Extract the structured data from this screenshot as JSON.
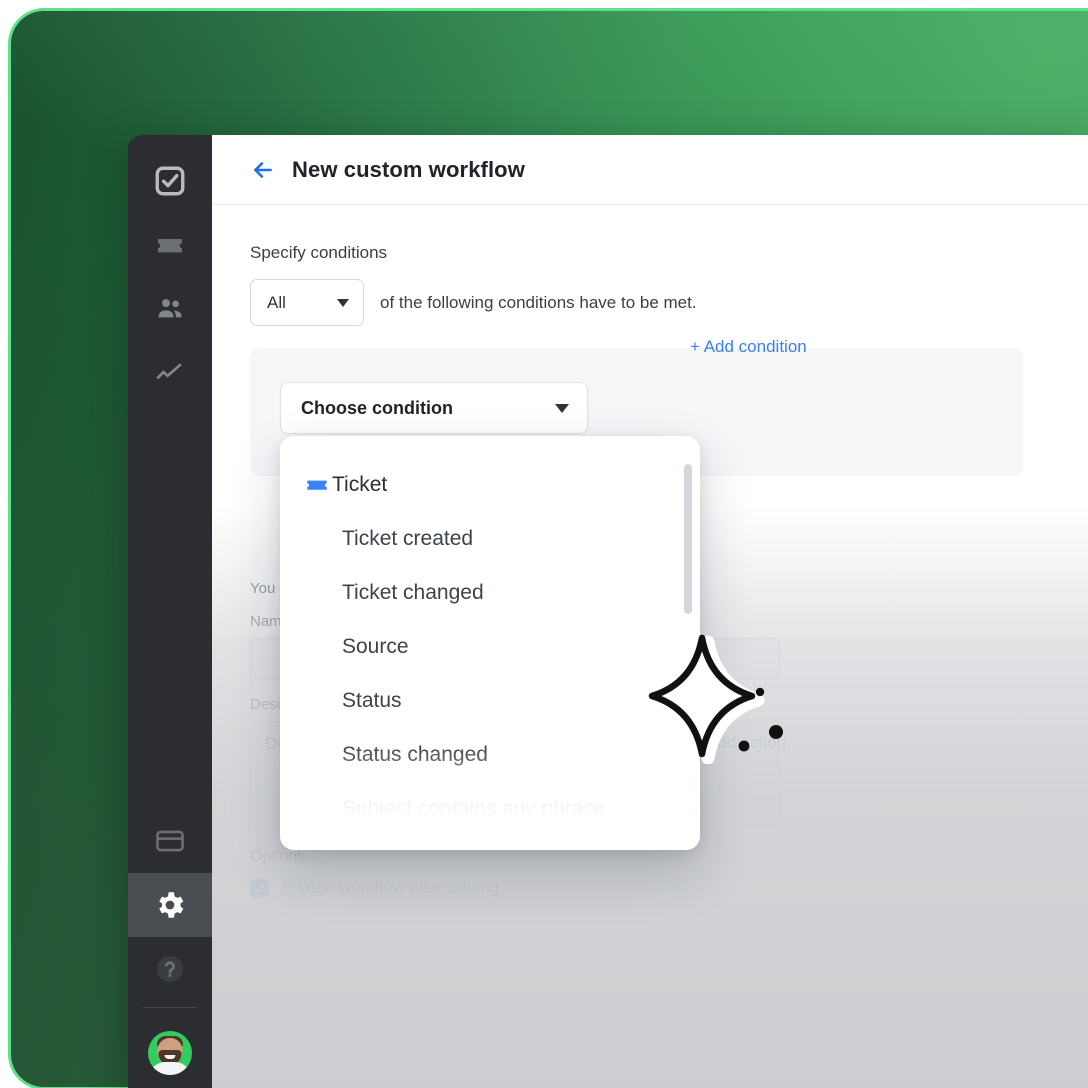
{
  "window": {
    "title": "New custom workflow",
    "back_icon": "arrow-left-icon",
    "accent_blue": "#3b7ff0",
    "card_green_light": "#5fe08a",
    "card_green_dark": "#27663e"
  },
  "sidebar": {
    "items": [
      {
        "icon": "checkbox-logo-icon",
        "name": "logo",
        "active": false
      },
      {
        "icon": "ticket-icon",
        "name": "tickets",
        "active": false
      },
      {
        "icon": "people-icon",
        "name": "contacts",
        "active": false
      },
      {
        "icon": "chart-line-icon",
        "name": "reports",
        "active": false
      },
      {
        "icon": "credit-card-icon",
        "name": "billing",
        "active": false
      },
      {
        "icon": "gear-icon",
        "name": "settings",
        "active": true
      },
      {
        "icon": "help-circle-icon",
        "name": "help",
        "active": false
      }
    ],
    "avatar": "user-avatar"
  },
  "conditions": {
    "section_label": "Specify conditions",
    "match_select_value": "All",
    "match_sentence": "of the following conditions have to be met.",
    "choose_condition_label": "Choose condition",
    "add_condition_label": "+ Add condition"
  },
  "actions": {
    "add_action_label": "+ Add action"
  },
  "dropdown": {
    "items": [
      {
        "label": "Ticket",
        "icon": "ticket-icon",
        "is_group": true,
        "faded": false
      },
      {
        "label": "Ticket created",
        "icon": "",
        "is_group": false,
        "faded": false
      },
      {
        "label": "Ticket changed",
        "icon": "",
        "is_group": false,
        "faded": false
      },
      {
        "label": "Source",
        "icon": "",
        "is_group": false,
        "faded": false
      },
      {
        "label": "Status",
        "icon": "",
        "is_group": false,
        "faded": false
      },
      {
        "label": "Status changed",
        "icon": "",
        "is_group": false,
        "faded": false
      },
      {
        "label": "Subject contains any phrase",
        "icon": "",
        "is_group": false,
        "faded": true
      }
    ],
    "ticket_icon_color": "#3b82f6"
  },
  "form": {
    "intro_text": "You",
    "name_label": "Name",
    "name_placeholder": "",
    "description_label": "Description",
    "description_placeholder": "Description",
    "options_label": "Options",
    "enable_label": "Enable workflow after adding",
    "enable_checked": true
  }
}
